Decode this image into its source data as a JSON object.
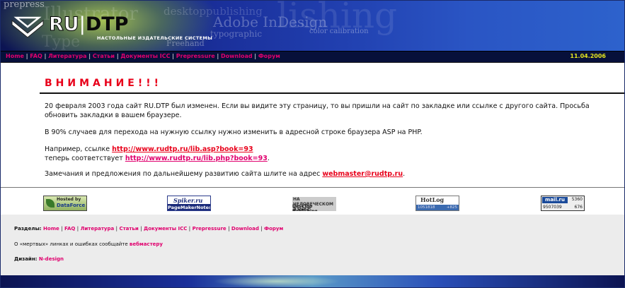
{
  "header": {
    "logo_ru": "RU",
    "logo_sep": "|",
    "logo_dtp": "DTP",
    "subtitle": "НАСТОЛЬНЫЕ ИЗДАТЕЛЬСКИЕ СИСТЕМЫ",
    "decor": [
      "prepress",
      "Adobe InDesign",
      "lishing",
      "typographic",
      "color calibration",
      "Freehand",
      "desktoppublishing",
      "Illustrator",
      "Type"
    ]
  },
  "nav": {
    "items": [
      "Home",
      "FAQ",
      "Литература",
      "Статьи",
      "Документы ICC",
      "Prepressure",
      "Download",
      "Форум"
    ],
    "separator": "|",
    "date": "11.04.2006"
  },
  "main": {
    "warning": "ВНИМАНИЕ!!!",
    "p1": "20 февраля 2003 года сайт RU.DTP был изменен. Если вы видите эту страницу, то вы пришли на сайт по закладке или ссылке с другого сайта. Просьба обновить закладки в вашем браузере.",
    "p2": "В 90% случаев для перехода на нужную ссылку нужно изменить в адресной строке браузера ASP на PHP.",
    "p3_prefix": "Например, ссылке ",
    "p3_link_old": "http://www.rudtp.ru/lib.asp?book=93",
    "p3_line2_prefix": "теперь соответствует ",
    "p3_link_new": "http://www.rudtp.ru/lib.php?book=93",
    "p3_suffix": ".",
    "p4_prefix": "Замечания и предложения по дальнейшему развитию сайта шлите на адрес ",
    "p4_email": "webmaster@rudtp.ru",
    "p4_suffix": "."
  },
  "badges": {
    "dataforce": {
      "line1": "Hosted by",
      "line2": "DataForce"
    },
    "spiker": {
      "line1": "Spiker.ru",
      "line2": "PageMakerNotes"
    },
    "desktop": {
      "line1": "НА ЧЕЛОВЕЧЕСКОМ ЯЗЫКЕ",
      "line2": "DeskTop Publishing"
    },
    "hotlog": {
      "title": "HotLog",
      "n1": "1051818",
      "n2": "+825"
    },
    "mailru": {
      "logo": "mail.ru",
      "n1": "5360",
      "n2": "9507039",
      "n3": "676"
    }
  },
  "footer": {
    "sections_label": "Разделы:",
    "broken_prefix": "О «мертвых» линках и ошибках сообщайте ",
    "broken_link": "вебмастеру",
    "design_label": "Дизайн:",
    "design_value": "N-design"
  },
  "colors": {
    "accent_pink": "#e0006e",
    "warning_red": "#e8001a",
    "date_yellow": "#e6e61e",
    "nav_bg": "#07103a"
  }
}
